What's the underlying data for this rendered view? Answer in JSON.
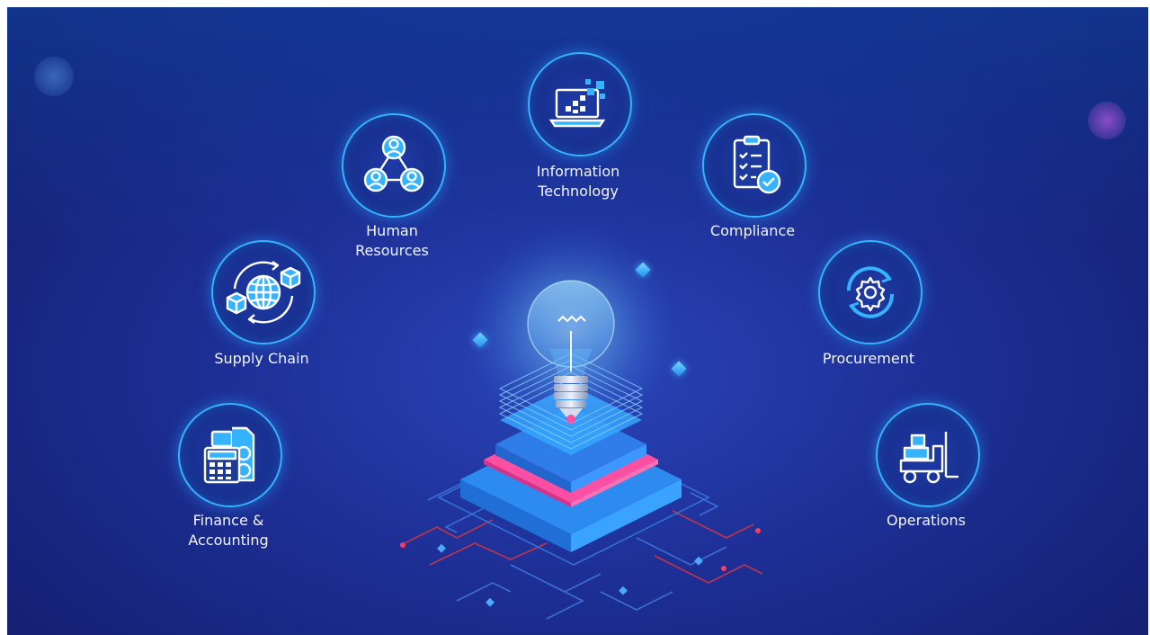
{
  "theme": {
    "accent": "#36b3ff",
    "background": "#1d2f95",
    "highlight_pink": "#ff4fa3"
  },
  "departments": [
    {
      "id": "finance",
      "label": "Finance &\nAccounting",
      "icon": "calculator-invoice-icon"
    },
    {
      "id": "supply",
      "label": "Supply Chain",
      "icon": "globe-boxes-icon"
    },
    {
      "id": "hr",
      "label": "Human\nResources",
      "icon": "people-network-icon"
    },
    {
      "id": "it",
      "label": "Information\nTechnology",
      "icon": "laptop-pixels-icon"
    },
    {
      "id": "compliance",
      "label": "Compliance",
      "icon": "clipboard-check-icon"
    },
    {
      "id": "procurement",
      "label": "Procurement",
      "icon": "gear-cycle-icon"
    },
    {
      "id": "operations",
      "label": "Operations",
      "icon": "forklift-icon"
    }
  ],
  "center": {
    "icon": "lightbulb-icon",
    "platform": "layered-platform"
  }
}
